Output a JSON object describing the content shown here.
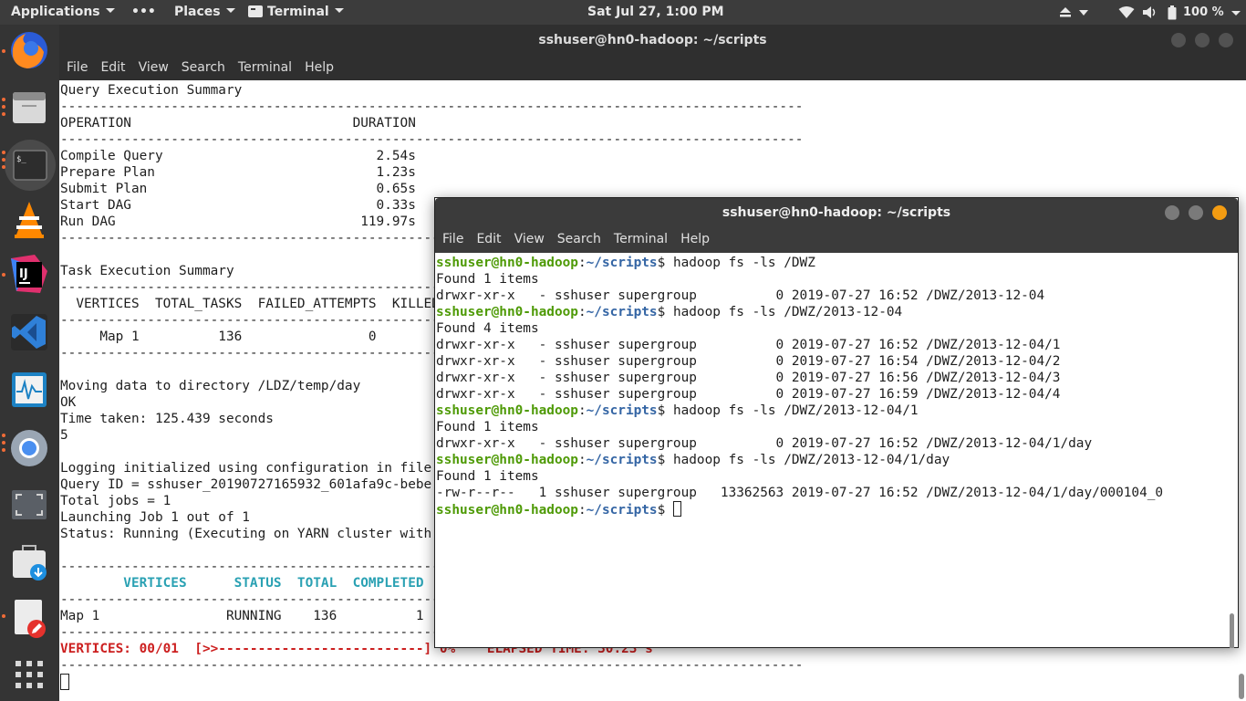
{
  "topbar": {
    "applications": "Applications",
    "more": "•••",
    "places": "Places",
    "terminal": "Terminal",
    "clock": "Sat Jul 27,  1:00 PM",
    "battery": "100 %"
  },
  "dock": {
    "items": [
      "firefox-icon",
      "files-icon",
      "terminal-icon",
      "vlc-icon",
      "intellij-icon",
      "vscode-icon",
      "system-monitor-icon",
      "chromium-icon",
      "screenshot-icon",
      "software-center-icon",
      "text-editor-icon",
      "app-grid-icon"
    ]
  },
  "bg_window": {
    "title": "sshuser@hn0-hadoop: ~/scripts",
    "menu": [
      "File",
      "Edit",
      "View",
      "Search",
      "Terminal",
      "Help"
    ],
    "lines": [
      {
        "t": "Query Execution Summary"
      },
      {
        "t": "----------------------------------------------------------------------------------------------"
      },
      {
        "t": "OPERATION                            DURATION"
      },
      {
        "t": "----------------------------------------------------------------------------------------------"
      },
      {
        "t": "Compile Query                           2.54s"
      },
      {
        "t": "Prepare Plan                            1.23s"
      },
      {
        "t": "Submit Plan                             0.65s"
      },
      {
        "t": "Start DAG                               0.33s"
      },
      {
        "t": "Run DAG                               119.97s"
      },
      {
        "t": "----------------------------------------------------------------------------------------------"
      },
      {
        "t": ""
      },
      {
        "t": "Task Execution Summary"
      },
      {
        "t": "----------------------------------------------------------------------------------------------"
      },
      {
        "t": "  VERTICES  TOTAL_TASKS  FAILED_ATTEMPTS  KILLED_TASKS"
      },
      {
        "t": "----------------------------------------------------------------------------------------------"
      },
      {
        "t": "     Map 1          136                0"
      },
      {
        "t": "----------------------------------------------------------------------------------------------"
      },
      {
        "t": ""
      },
      {
        "t": "Moving data to directory /LDZ/temp/day"
      },
      {
        "t": "OK"
      },
      {
        "t": "Time taken: 125.439 seconds"
      },
      {
        "t": "5"
      },
      {
        "t": ""
      },
      {
        "t": "Logging initialized using configuration in file"
      },
      {
        "t": "Query ID = sshuser_20190727165932_601afa9c-bebe"
      },
      {
        "t": "Total jobs = 1"
      },
      {
        "t": "Launching Job 1 out of 1"
      },
      {
        "t": "Status: Running (Executing on YARN cluster with"
      },
      {
        "t": ""
      },
      {
        "t": "----------------------------------------------------------------------------------------------"
      },
      {
        "t": "        VERTICES      STATUS  TOTAL  COMPLETED",
        "c": "cyan"
      },
      {
        "t": "----------------------------------------------------------------------------------------------"
      },
      {
        "t": "Map 1                RUNNING    136          1"
      },
      {
        "t": "----------------------------------------------------------------------------------------------"
      },
      {
        "t": "VERTICES: 00/01  [>>--------------------------] 0%    ELAPSED TIME: 30.23 s",
        "c": "red"
      },
      {
        "t": "----------------------------------------------------------------------------------------------"
      }
    ]
  },
  "fg_window": {
    "title": "sshuser@hn0-hadoop: ~/scripts",
    "menu": [
      "File",
      "Edit",
      "View",
      "Search",
      "Terminal",
      "Help"
    ],
    "prompt_user": "sshuser@hn0-hadoop",
    "prompt_path": "~/scripts",
    "lines": [
      {
        "cmd": "hadoop fs -ls /DWZ"
      },
      {
        "t": "Found 1 items"
      },
      {
        "t": "drwxr-xr-x   - sshuser supergroup          0 2019-07-27 16:52 /DWZ/2013-12-04"
      },
      {
        "cmd": "hadoop fs -ls /DWZ/2013-12-04"
      },
      {
        "t": "Found 4 items"
      },
      {
        "t": "drwxr-xr-x   - sshuser supergroup          0 2019-07-27 16:52 /DWZ/2013-12-04/1"
      },
      {
        "t": "drwxr-xr-x   - sshuser supergroup          0 2019-07-27 16:54 /DWZ/2013-12-04/2"
      },
      {
        "t": "drwxr-xr-x   - sshuser supergroup          0 2019-07-27 16:56 /DWZ/2013-12-04/3"
      },
      {
        "t": "drwxr-xr-x   - sshuser supergroup          0 2019-07-27 16:59 /DWZ/2013-12-04/4"
      },
      {
        "cmd": "hadoop fs -ls /DWZ/2013-12-04/1"
      },
      {
        "t": "Found 1 items"
      },
      {
        "t": "drwxr-xr-x   - sshuser supergroup          0 2019-07-27 16:52 /DWZ/2013-12-04/1/day"
      },
      {
        "cmd": "hadoop fs -ls /DWZ/2013-12-04/1/day"
      },
      {
        "t": "Found 1 items"
      },
      {
        "t": "-rw-r--r--   1 sshuser supergroup   13362563 2019-07-27 16:52 /DWZ/2013-12-04/1/day/000104_0"
      },
      {
        "cmd": "",
        "cursor": true
      }
    ]
  },
  "colors": {
    "prompt_user": "#4e9a06",
    "prompt_path": "#3465a4",
    "close_active": "#f39c12",
    "cyan_header": "#2aa1b3",
    "error_red": "#cc1f1f"
  }
}
